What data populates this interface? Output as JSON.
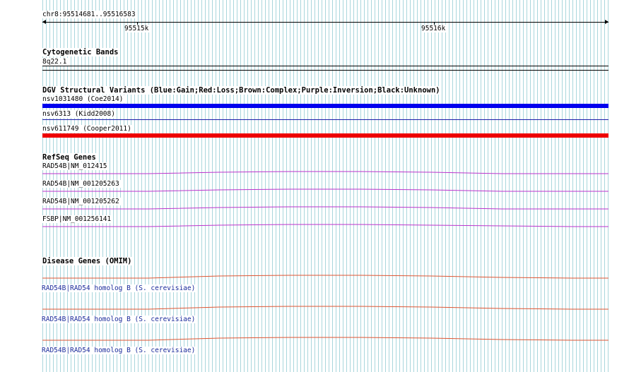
{
  "ruler": {
    "location": "chr8:95514681..95516583",
    "tick_labels": [
      "95515k",
      "95516k"
    ]
  },
  "cytoband": {
    "title": "Cytogenetic Bands",
    "band": "8q22.1"
  },
  "dgv": {
    "title": "DGV Structural Variants (Blue:Gain;Red:Loss;Brown:Complex;Purple:Inversion;Black:Unknown)",
    "variants": [
      {
        "label": "nsv1031480 (Coe2014)",
        "color": "#0000ee",
        "type": "Gain"
      },
      {
        "label": "nsv6313 (Kidd2008)",
        "color": "#1c1ca8",
        "type": "Gain"
      },
      {
        "label": "nsv611749 (Cooper2011)",
        "color": "#ee0000",
        "type": "Loss"
      }
    ]
  },
  "refseq": {
    "title": "RefSeq Genes",
    "color": "#bb33cc",
    "genes": [
      {
        "label": "RAD54B|NM_012415"
      },
      {
        "label": "RAD54B|NM_001205263"
      },
      {
        "label": "RAD54B|NM_001205262"
      },
      {
        "label": "FSBP|NM_001256141"
      }
    ]
  },
  "omim": {
    "title": "Disease Genes (OMIM)",
    "color": "#dd5533",
    "genes": [
      {
        "label": "RAD54B|RAD54 homolog B (S. cerevisiae)"
      },
      {
        "label": "RAD54B|RAD54 homolog B (S. cerevisiae)"
      },
      {
        "label": "RAD54B|RAD54 homolog B (S. cerevisiae)"
      }
    ]
  }
}
